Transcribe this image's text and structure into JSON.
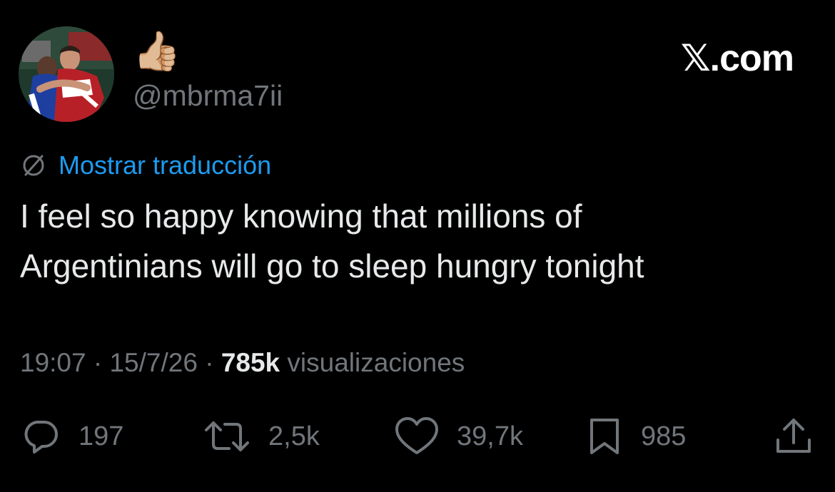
{
  "user": {
    "display_name": "👍🏼",
    "handle": "@mbrma7ii"
  },
  "brand": {
    "label": "𝕏.com"
  },
  "translation": {
    "label": "Mostrar traducción",
    "icon": "globe-slash-icon"
  },
  "tweet": {
    "line1": "I feel so happy knowing that millions of",
    "line2": "Argentinians will go to sleep hungry tonight"
  },
  "meta": {
    "time": "19:07",
    "separator": " · ",
    "date": "15/7/26",
    "views_count": "785k",
    "views_label": " visualizaciones"
  },
  "actions": {
    "replies": {
      "icon": "reply-icon",
      "count": "197"
    },
    "reposts": {
      "icon": "repost-icon",
      "count": "2,5k"
    },
    "likes": {
      "icon": "heart-icon",
      "count": "39,7k"
    },
    "bookmarks": {
      "icon": "bookmark-icon",
      "count": "985"
    },
    "share": {
      "icon": "share-icon"
    }
  },
  "colors": {
    "background": "#000000",
    "text": "#e7e9ea",
    "secondary": "#71767b",
    "link": "#1d9bf0"
  }
}
